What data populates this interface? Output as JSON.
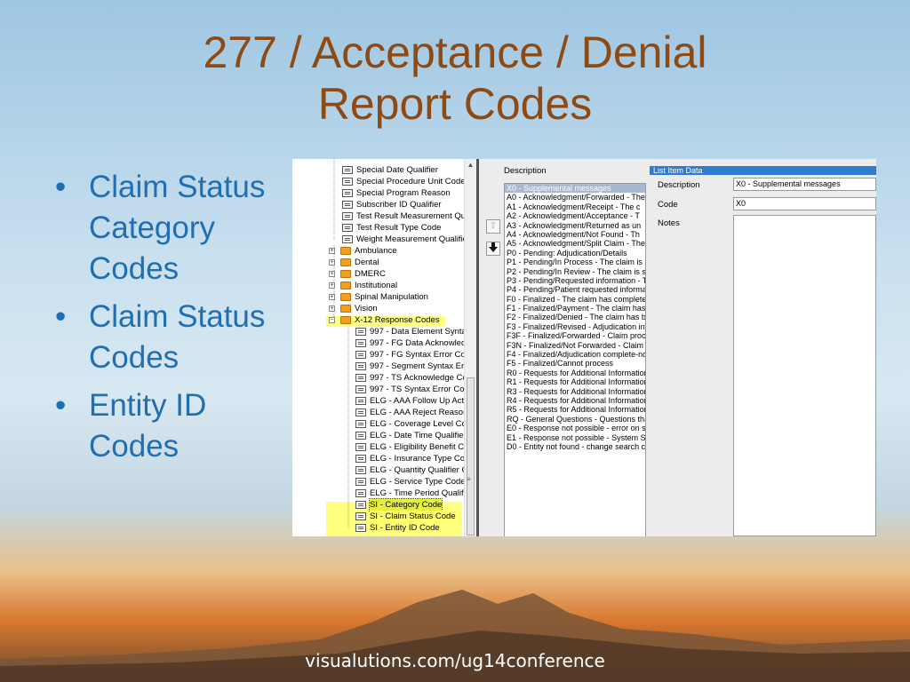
{
  "slide": {
    "title_line1": "277 / Acceptance / Denial",
    "title_line2": "Report Codes",
    "bullets": [
      "Claim Status Category Codes",
      "Claim Status Codes",
      "Entity ID Codes"
    ],
    "footer": "visualutions.com/ug14conference"
  },
  "tree": {
    "items": [
      {
        "label": "Special Date Qualifier",
        "kind": "file"
      },
      {
        "label": "Special Procedure Unit Code",
        "kind": "file"
      },
      {
        "label": "Special Program Reason",
        "kind": "file"
      },
      {
        "label": "Subscriber ID Qualifier",
        "kind": "file"
      },
      {
        "label": "Test Result Measurement Qua",
        "kind": "file"
      },
      {
        "label": "Test Result Type Code",
        "kind": "file"
      },
      {
        "label": "Weight Measurement Qualifier",
        "kind": "file"
      },
      {
        "label": "Ambulance",
        "kind": "folder"
      },
      {
        "label": "Dental",
        "kind": "folder"
      },
      {
        "label": "DMERC",
        "kind": "folder"
      },
      {
        "label": "Institutional",
        "kind": "folder"
      },
      {
        "label": "Spinal Manipulation",
        "kind": "folder"
      },
      {
        "label": "Vision",
        "kind": "folder"
      },
      {
        "label": "X-12 Response Codes",
        "kind": "folder-open"
      },
      {
        "label": "997 - Data Element Syntax",
        "kind": "file2"
      },
      {
        "label": "997 - FG Data Acknowledg",
        "kind": "file2"
      },
      {
        "label": "997 - FG Syntax Error Code",
        "kind": "file2"
      },
      {
        "label": "997 - Segment Syntax Erro",
        "kind": "file2"
      },
      {
        "label": "997 - TS Acknowledge Co",
        "kind": "file2"
      },
      {
        "label": "997 - TS Syntax Error Code",
        "kind": "file2"
      },
      {
        "label": "ELG - AAA Follow Up Actio",
        "kind": "file2"
      },
      {
        "label": "ELG - AAA Reject Reason",
        "kind": "file2"
      },
      {
        "label": "ELG - Coverage Level Coc",
        "kind": "file2"
      },
      {
        "label": "ELG - Date Time Qualifier",
        "kind": "file2"
      },
      {
        "label": "ELG - Eligibility Benefit Coc",
        "kind": "file2"
      },
      {
        "label": "ELG - Insurance Type Cod",
        "kind": "file2"
      },
      {
        "label": "ELG - Quantity Qualifier Co",
        "kind": "file2"
      },
      {
        "label": "ELG - Service Type Code",
        "kind": "file2"
      },
      {
        "label": "ELG - Time Period Qualifier",
        "kind": "file2"
      },
      {
        "label": "SI - Category Code",
        "kind": "file2-sel"
      },
      {
        "label": "SI - Claim Status Code",
        "kind": "file2-hl"
      },
      {
        "label": "SI - Entity ID Code",
        "kind": "file2-hl"
      }
    ]
  },
  "list": {
    "header": "Description",
    "items": [
      "X0 - Supplemental messages",
      "A0 - Acknowledgment/Forwarded - The",
      "A1 - Acknowledgment/Receipt - The c",
      "A2 - Acknowledgment/Acceptance - T",
      "A3 - Acknowledgment/Returned as un",
      "A4 - Acknowledgment/Not Found - Th",
      "A5 - Acknowledgment/Split Claim - The",
      "P0 - Pending: Adjudication/Details",
      "P1 - Pending/In Process - The claim is i",
      "P2 - Pending/In Review - The claim is s",
      "P3 - Pending/Requested information - T",
      "P4 - Pending/Patient requested informat",
      "F0 - Finalized - The claim has completed",
      "F1 - Finalized/Payment - The claim has l",
      "F2 - Finalized/Denied - The claim has be",
      "F3 - Finalized/Revised - Adjudication inf",
      "F3F - Finalized/Forwarded - Claim proce",
      "F3N - Finalized/Not Forwarded - Claim p",
      "F4 - Finalized/Adjudication complete-no",
      "F5 - Finalized/Cannot process",
      "R0 - Requests for Additional Information",
      "R1 - Requests for Additional Information",
      "R3 - Requests for Additional Information",
      "R4 - Requests for Additional Information",
      "R5 - Requests for Additional Information",
      "RQ - General Questions - Questions that",
      "E0 - Response not possible - error on su",
      "E1 - Response not possible - System Sta",
      "D0 - Entity not found - change search cr"
    ],
    "up_icon": "⇧",
    "down_icon": "🡇"
  },
  "panel": {
    "header": "List Item Data",
    "description_label": "Description",
    "description_value": "X0 - Supplemental messages",
    "code_label": "Code",
    "code_value": "X0",
    "notes_label": "Notes"
  }
}
